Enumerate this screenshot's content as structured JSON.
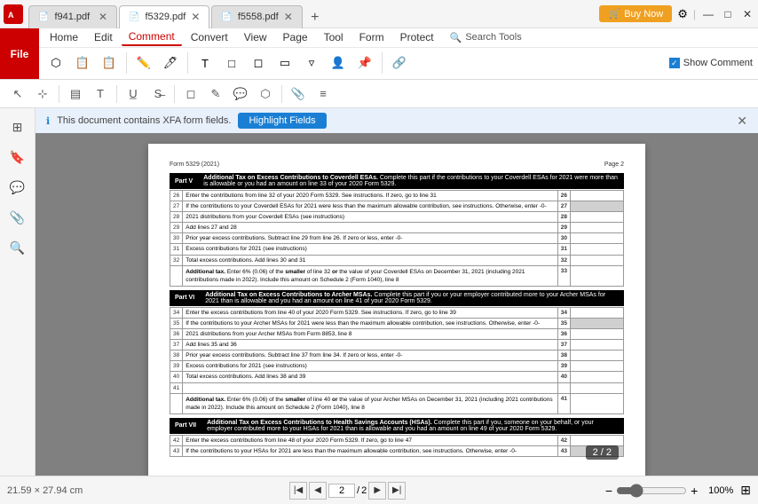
{
  "app": {
    "icon": "A",
    "tabs": [
      {
        "id": "f941",
        "label": "f941.pdf",
        "active": false
      },
      {
        "id": "f5329",
        "label": "f5329.pdf",
        "active": true
      },
      {
        "id": "f5558",
        "label": "f5558.pdf",
        "active": false
      }
    ],
    "add_tab_label": "+",
    "buy_now": "Buy Now",
    "win_controls": [
      "—",
      "□",
      "✕"
    ]
  },
  "ribbon": {
    "file_label": "File",
    "menu_items": [
      "Home",
      "Edit",
      "Comment",
      "Convert",
      "View",
      "Page",
      "Tool",
      "Form",
      "Protect"
    ],
    "active_menu": "Comment",
    "search_tools_label": "Search Tools"
  },
  "comment_toolbar": {
    "show_comment_label": "Show Comment"
  },
  "banner": {
    "message": "This document contains XFA form fields.",
    "highlight_btn": "Highlight Fields",
    "close": "✕"
  },
  "document": {
    "form_label": "Form 5329 (2021)",
    "page_label": "Page 2",
    "sections": [
      {
        "part": "Part V",
        "title": "Additional Tax on Excess Contributions to Coverdell ESAs.",
        "description": "Complete this part if the contributions to your Coverdell ESAs for 2021 were more than is allowable or you had an amount on line 33 of your 2020 Form 5329.",
        "rows": [
          {
            "num": "26",
            "desc": "Enter the contributions from line 32 of your 2020 Form 5329. See instructions. If zero, go to line 31",
            "box": "26",
            "shaded": false
          },
          {
            "num": "27",
            "desc": "If the contributions to your Coverdell ESAs for 2021 were less than the maximum allowable contribution, see instructions. Otherwise, enter -0-",
            "box": "27",
            "shaded": true
          },
          {
            "num": "28",
            "desc": "2021 distributions from your Coverdell ESAs (see instructions)",
            "box": "28",
            "shaded": false
          },
          {
            "num": "29",
            "desc": "Add lines 27 and 28",
            "box": "29",
            "shaded": false
          },
          {
            "num": "30",
            "desc": "Prior year excess contributions. Subtract line 29 from line 26. If zero or less, enter -0-",
            "box": "30",
            "shaded": false
          },
          {
            "num": "31",
            "desc": "Excess contributions for 2021 (see instructions)",
            "box": "31",
            "shaded": false
          },
          {
            "num": "32",
            "desc": "Total excess contributions. Add lines 30 and 31",
            "box": "32",
            "shaded": false
          },
          {
            "num": "33",
            "desc": "Additional tax. Enter 6% (0.06) of the smaller of line 32 or the value of your Coverdell ESAs on December 31, 2021 (including 2021 contributions made in 2022). Include this amount on Schedule 2 (Form 1040), line 8",
            "box": "33",
            "shaded": false
          }
        ]
      },
      {
        "part": "Part VI",
        "title": "Additional Tax on Excess Contributions to Archer MSAs.",
        "description": "Complete this part if you or your employer contributed more to your Archer MSAs for 2021 than is allowable and you had an amount on line 41 of your 2020 Form 5329.",
        "rows": [
          {
            "num": "34",
            "desc": "Enter the excess contributions from line 40 of your 2020 Form 5329. See instructions. If zero, go to line 39",
            "box": "34",
            "shaded": false
          },
          {
            "num": "35",
            "desc": "If the contributions to your Archer MSAs for 2021 were less than the maximum allowable contribution, see instructions. Otherwise, enter -0-",
            "box": "35",
            "shaded": true
          },
          {
            "num": "36",
            "desc": "2021 distributions from your Archer MSAs from Form 8853, line 8",
            "box": "36",
            "shaded": false
          },
          {
            "num": "37",
            "desc": "Add lines 35 and 36",
            "box": "37",
            "shaded": false
          },
          {
            "num": "38",
            "desc": "Prior year excess contributions. Subtract line 37 from line 34. If zero or less, enter -0-",
            "box": "38",
            "shaded": false
          },
          {
            "num": "39",
            "desc": "Excess contributions for 2021 (see instructions)",
            "box": "39",
            "shaded": false
          },
          {
            "num": "40",
            "desc": "Total excess contributions. Add lines 38 and 39",
            "box": "40",
            "shaded": false
          },
          {
            "num": "41",
            "desc": "",
            "box": "41",
            "shaded": false
          },
          {
            "num": "",
            "desc": "Additional tax. Enter 6% (0.06) of the smaller of line 40 or the value of your Archer MSAs on December 31, 2021 (including 2021 contributions made in 2022). Include this amount on Schedule 2 (Form 1040), line 8",
            "box": "41",
            "shaded": false
          }
        ]
      },
      {
        "part": "Part VII",
        "title": "Additional Tax on Excess Contributions to Health Savings Accounts (HSAs).",
        "description": "Complete this part if you, someone on your behalf, or your employer contributed more to your HSAs for 2021 than is allowable and you had an amount on line 49 of your 2020 Form 5329.",
        "rows": [
          {
            "num": "42",
            "desc": "Enter the excess contributions from line 48 of your 2020 Form 5329. If zero, go to line 47",
            "box": "42",
            "shaded": false
          },
          {
            "num": "43",
            "desc": "If the contributions to your HSAs for 2021 are less than the maximum allowable contribution, see instructions. Otherwise, enter -0-",
            "box": "43",
            "shaded": true
          }
        ]
      }
    ]
  },
  "bottom_bar": {
    "size_label": "21.59 × 27.94 cm",
    "page_current": "2",
    "page_total": "2",
    "page_display": "2 / 2",
    "zoom_value": "100%",
    "zoom_percent": "100"
  },
  "page_badge": "2 / 2"
}
